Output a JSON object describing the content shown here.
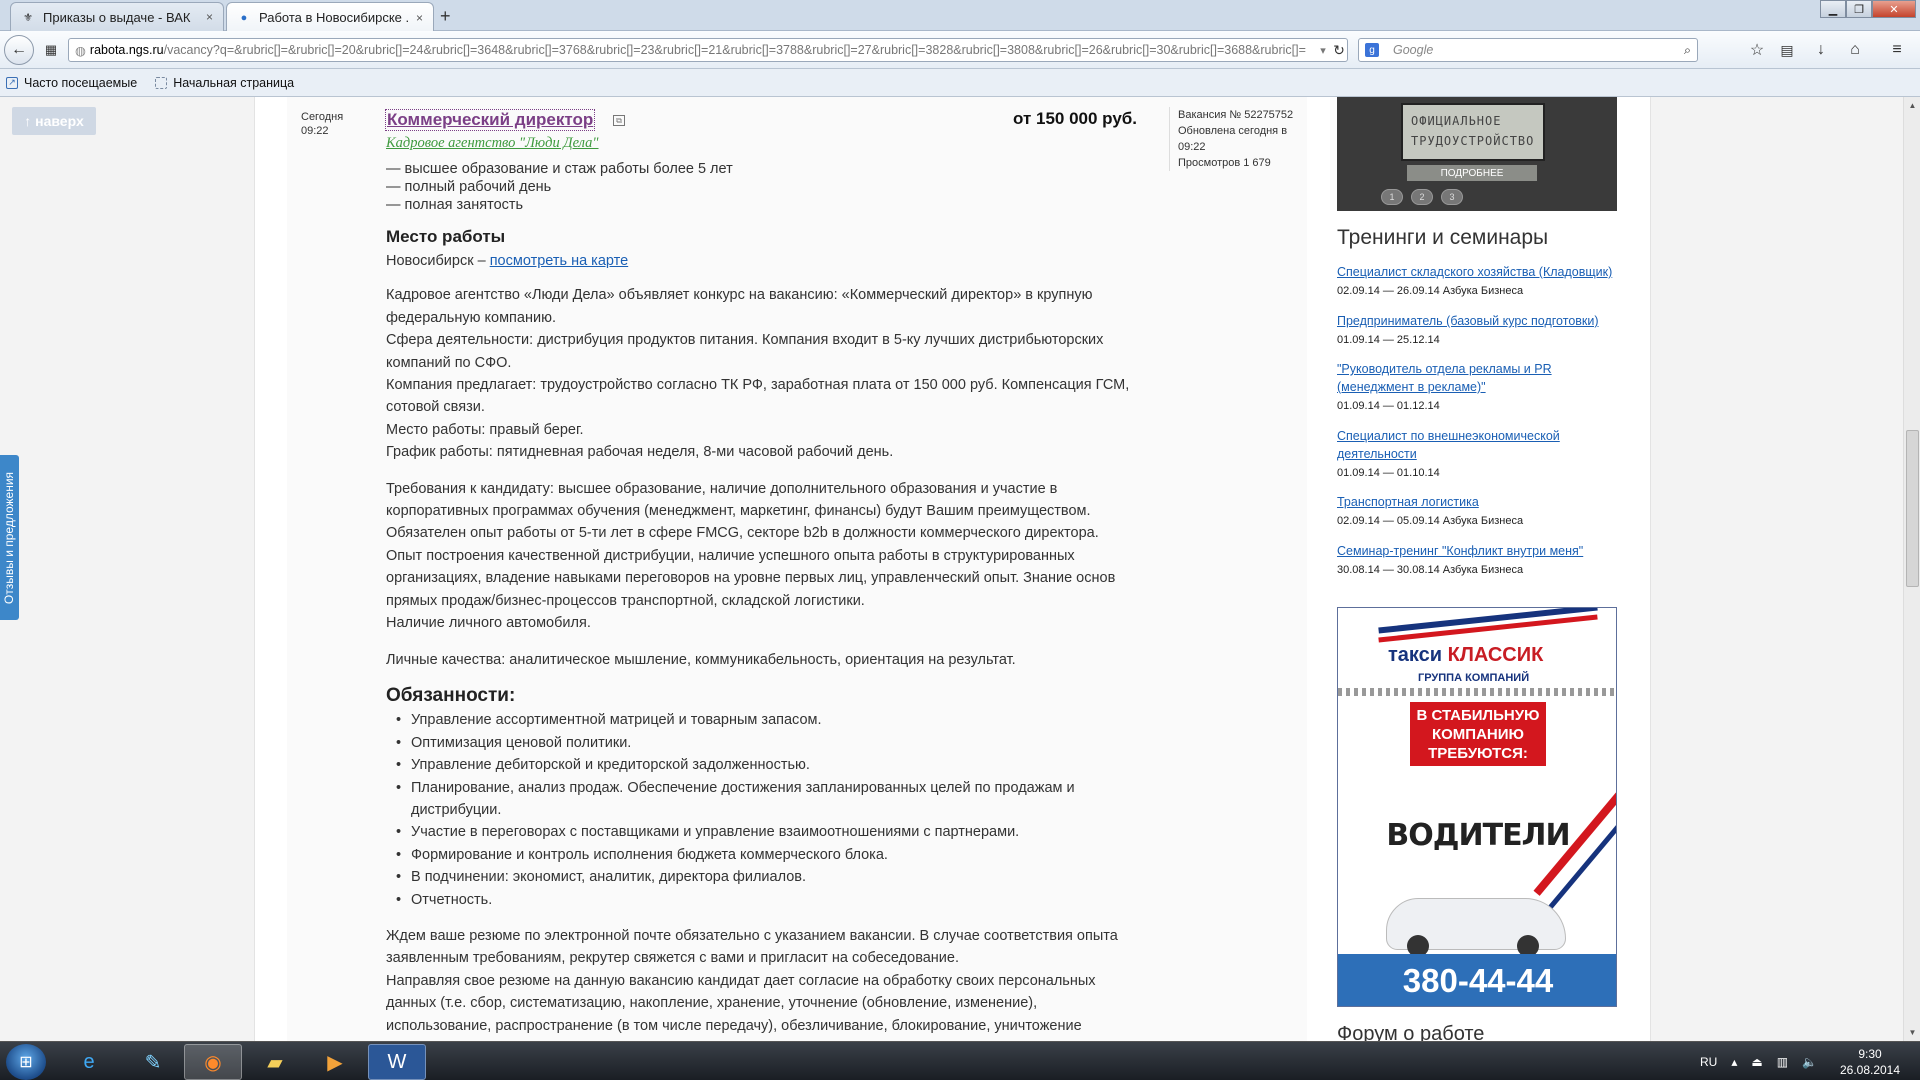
{
  "browser": {
    "tabs": [
      {
        "title": "Приказы о выдаче - ВАК",
        "close": "×"
      },
      {
        "title": "Работа в Новосибирске ...",
        "close": "×"
      }
    ],
    "new_tab": "+",
    "url_host": "rabota.ngs.ru",
    "url_path": "/vacancy?q=&rubric[]=&rubric[]=20&rubric[]=24&rubric[]=3648&rubric[]=3768&rubric[]=23&rubric[]=21&rubric[]=3788&rubric[]=27&rubric[]=3828&rubric[]=3808&rubric[]=26&rubric[]=30&rubric[]=3688&rubric[]=",
    "search_placeholder": "Google",
    "bookmarks": [
      "Часто посещаемые",
      "Начальная страница"
    ]
  },
  "page": {
    "up_button": "↑ наверх",
    "feedback_tab": "Отзывы и предложения"
  },
  "vacancy": {
    "date_day": "Сегодня",
    "date_time": "09:22",
    "title": "Коммерческий директор",
    "salary": "от 150 000 руб.",
    "agency": "Кадровое агентство \"Люди Дела\"",
    "meta": {
      "number": "Вакансия № 52275752",
      "updated": "Обновлена сегодня в 09:22",
      "views": "Просмотров 1 679"
    },
    "requirements": [
      "— высшее образование и стаж работы более 5 лет",
      "— полный рабочий день",
      "— полная занятость"
    ],
    "workplace_heading": "Место работы",
    "city": "Новосибирск – ",
    "map_link": "посмотреть на карте",
    "intro_lines": [
      "Кадровое агентство «Люди Дела» объявляет конкурс на вакансию: «Коммерческий директор» в крупную федеральную компанию.",
      "Сфера деятельности: дистрибуция продуктов питания. Компания входит в 5-ку лучших дистрибьюторских компаний по СФО.",
      "Компания предлагает: трудоустройство согласно ТК РФ, заработная плата от 150 000 руб. Компенсация ГСМ, сотовой связи.",
      "Место работы: правый берег.",
      "График работы: пятидневная рабочая неделя, 8-ми часовой рабочий день."
    ],
    "requirements_text": [
      "Требования к кандидату: высшее образование, наличие дополнительного образования и участие в корпоративных программах обучения (менеджмент, маркетинг, финансы) будут Вашим преимуществом.",
      "Обязателен опыт работы от 5-ти лет в сфере FMCG, секторе b2b в должности коммерческого директора.",
      "Опыт построения качественной дистрибуции, наличие успешного опыта работы в структурированных организациях, владение навыками переговоров на уровне первых лиц, управленческий опыт. Знание основ прямых продаж/бизнес-процессов транспортной, складской логистики.",
      "Наличие личного автомобиля."
    ],
    "personal": "Личные качества: аналитическое мышление, коммуникабельность, ориентация на результат.",
    "duties_heading": "Обязанности:",
    "duties": [
      "Управление ассортиментной матрицей и товарным запасом.",
      "Оптимизация ценовой политики.",
      "Управление дебиторской и кредиторской задолженностью.",
      "Планирование, анализ продаж. Обеспечение достижения запланированных целей по продажам и дистрибуции.",
      "Участие в переговорах с поставщиками и управление взаимоотношениями с партнерами.",
      "Формирование и контроль исполнения бюджета коммерческого блока.",
      "В подчинении: экономист, аналитик, директора филиалов.",
      "Отчетность."
    ],
    "closing": [
      "Ждем ваше резюме по электронной почте обязательно с указанием вакансии. В случае соответствия опыта заявленным требованиям, рекрутер свяжется с вами и пригласит на собеседование.",
      "Направляя свое резюме на данную вакансию кандидат дает согласие на обработку своих персональных данных (т.е. сбор, систематизацию, накопление, хранение, уточнение (обновление, изменение), использование, распространение (в том числе передачу), обезличивание, блокирование, уничтожение"
    ]
  },
  "sidebar": {
    "banner_screen_line1": "ОФИЦИАЛЬНОЕ",
    "banner_screen_line2": "ТРУДОУСТРОЙСТВО",
    "banner_more": "ПОДРОБНЕЕ",
    "banner_keys": [
      "1",
      "2",
      "3"
    ],
    "trainings_title": "Тренинги и семинары",
    "trainings": [
      {
        "title": "Специалист складского хозяйства (Кладовщик)",
        "date": "02.09.14 — 26.09.14 Азбука Бизнеса"
      },
      {
        "title": "Предприниматель (базовый курс подготовки)",
        "date": "01.09.14 — 25.12.14"
      },
      {
        "title": "\"Руководитель отдела рекламы и PR (менеджмент в рекламе)\"",
        "date": "01.09.14 — 01.12.14"
      },
      {
        "title": "Специалист по внешнеэкономической деятельности",
        "date": "01.09.14 — 01.10.14"
      },
      {
        "title": "Транспортная логистика",
        "date": "02.09.14 — 05.09.14 Азбука Бизнеса"
      },
      {
        "title": "Семинар-тренинг \"Конфликт внутри меня\"",
        "date": "30.08.14 — 30.08.14 Азбука Бизнеса"
      }
    ],
    "taxi": {
      "brand_prefix": "такси ",
      "brand_name": "КЛАССИК",
      "group": "ГРУППА КОМПАНИЙ",
      "red_text": "В СТАБИЛЬНУЮ КОМПАНИЮ ТРЕБУЮТСЯ:",
      "drivers": "ВОДИТЕЛИ",
      "phone": "380-44-44"
    },
    "forum_title": "Форум о работе"
  },
  "taskbar": {
    "lang": "RU",
    "time": "9:30",
    "date": "26.08.2014"
  }
}
